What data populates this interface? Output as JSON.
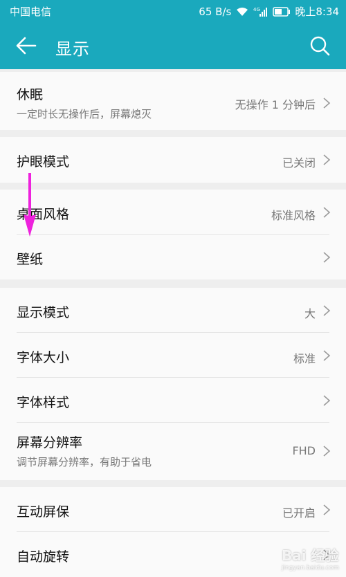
{
  "status": {
    "carrier": "中国电信",
    "speed": "65 B/s",
    "time": "晚上8:34"
  },
  "header": {
    "title": "显示"
  },
  "sections": [
    {
      "rows": [
        {
          "label": "休眠",
          "sub": "一定时长无操作后，屏幕熄灭",
          "value": "无操作 1 分钟后"
        }
      ]
    },
    {
      "rows": [
        {
          "label": "护眼模式",
          "value": "已关闭"
        }
      ]
    },
    {
      "rows": [
        {
          "label": "桌面风格",
          "value": "标准风格"
        },
        {
          "label": "壁纸",
          "value": ""
        }
      ]
    },
    {
      "rows": [
        {
          "label": "显示模式",
          "value": "大"
        },
        {
          "label": "字体大小",
          "value": "标准"
        },
        {
          "label": "字体样式",
          "value": ""
        },
        {
          "label": "屏幕分辨率",
          "sub": "调节屏幕分辨率，有助于省电",
          "value": "FHD"
        }
      ]
    },
    {
      "rows": [
        {
          "label": "互动屏保",
          "value": "已开启"
        },
        {
          "label": "自动旋转",
          "value": ""
        }
      ]
    }
  ],
  "watermark": {
    "text": "Bai 经验",
    "sub": "jingyan.baidu.com"
  },
  "colors": {
    "header": "#1aa9bd",
    "arrow": "#ee22dd"
  }
}
